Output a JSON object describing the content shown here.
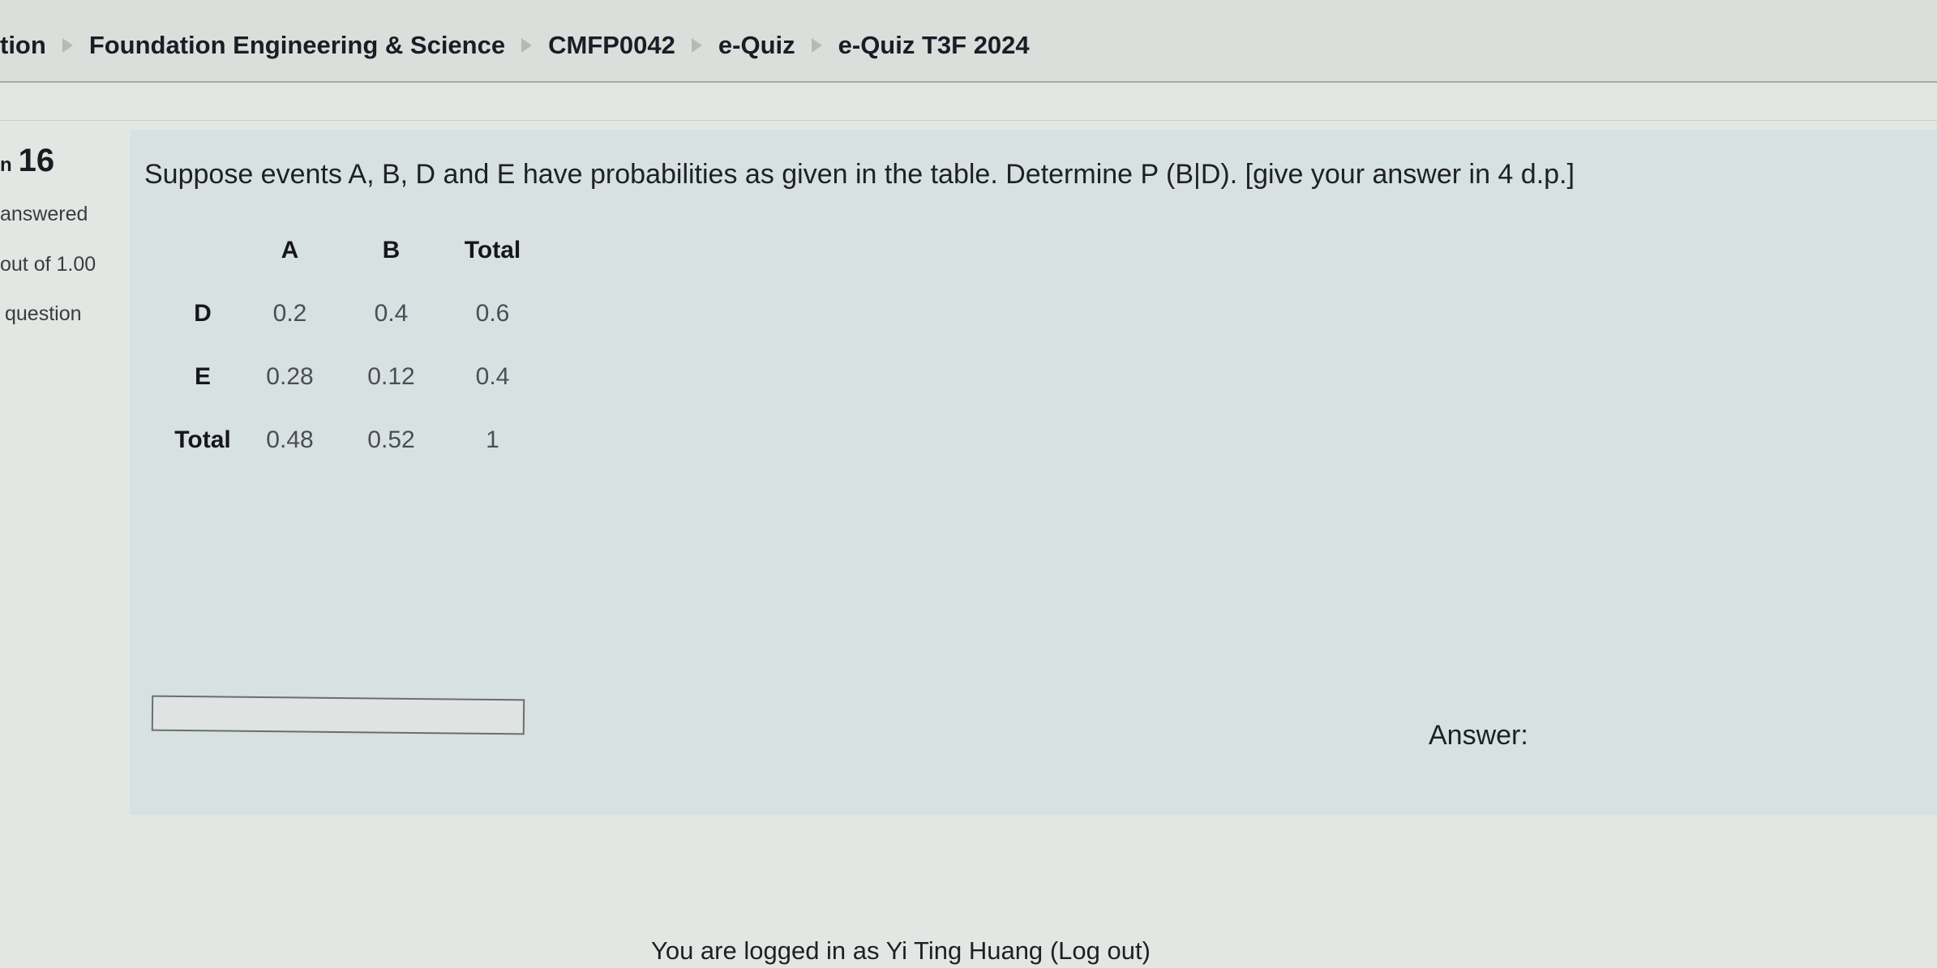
{
  "breadcrumb": {
    "items": [
      "tion",
      "Foundation Engineering & Science",
      "CMFP0042",
      "e-Quiz",
      "e-Quiz T3F 2024"
    ],
    "separator_icon": "triangle-right-icon"
  },
  "question_info": {
    "number_prefix": "n",
    "number": "16",
    "status": "answered",
    "marks": "out of 1.00",
    "flag": "question"
  },
  "question": {
    "text": "Suppose events A, B, D and E have probabilities as given in the table. Determine P (B|D). [give your answer in 4 d.p.]",
    "table": {
      "columns": [
        "",
        "A",
        "B",
        "Total"
      ],
      "rows": [
        {
          "label": "D",
          "values": [
            "0.2",
            "0.4",
            "0.6"
          ]
        },
        {
          "label": "E",
          "values": [
            "0.28",
            "0.12",
            "0.4"
          ]
        },
        {
          "label": "Total",
          "values": [
            "0.48",
            "0.52",
            "1"
          ]
        }
      ]
    },
    "answer_label": "Answer:",
    "answer_value": ""
  },
  "footer": {
    "logged_in_text": "You are logged in as",
    "user_name": "Yi Ting Huang",
    "logout_label": "(Log out)"
  }
}
